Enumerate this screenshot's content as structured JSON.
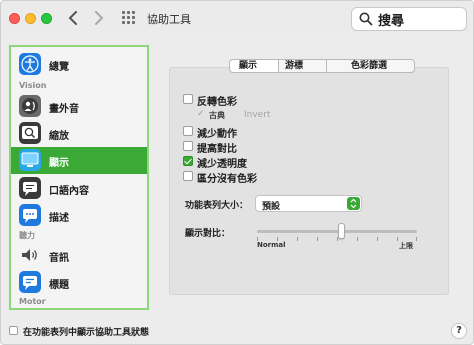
{
  "window": {
    "title": "協助工具"
  },
  "search": {
    "value": "搜尋",
    "placeholder": "搜尋"
  },
  "sidebar": {
    "section_vision": "Vision",
    "section_hearing": "聽力",
    "section_motor": "Motor",
    "items": [
      {
        "label": "總覽",
        "icon": "accessibility-icon"
      },
      {
        "label": "畫外音",
        "icon": "voiceover-icon"
      },
      {
        "label": "縮放",
        "icon": "zoom-icon"
      },
      {
        "label": "顯示",
        "icon": "display-icon",
        "selected": true
      },
      {
        "label": "口語內容",
        "icon": "spoken-content-icon"
      },
      {
        "label": "描述",
        "icon": "descriptions-icon"
      },
      {
        "label": "音訊",
        "icon": "audio-icon"
      },
      {
        "label": "標題",
        "icon": "captions-icon"
      }
    ]
  },
  "tabs": [
    {
      "label": "顯示",
      "selected": true
    },
    {
      "label": "游標",
      "selected": false
    },
    {
      "label": "色彩篩選",
      "selected": false
    }
  ],
  "options": [
    {
      "label": "反轉色彩",
      "checked": false
    },
    {
      "label": "減少動作",
      "checked": false
    },
    {
      "label": "提高對比",
      "checked": false
    },
    {
      "label": "減少透明度",
      "checked": true
    },
    {
      "label": "區分沒有色彩",
      "checked": false
    }
  ],
  "invert_sub": {
    "label": "古典",
    "extra": "Invert"
  },
  "menu_bar_size": {
    "label": "功能表列大小：",
    "value": "預設"
  },
  "display_contrast": {
    "label": "顯示對比：",
    "min_label": "Normal",
    "max_label": "上限",
    "value": 0.5
  },
  "footer": {
    "checkbox_label": "在功能表列中顯示協助工具狀態",
    "checked": false,
    "help": "?"
  },
  "colors": {
    "accent": "#3aa935",
    "sidebar_border": "#8ed67a"
  }
}
